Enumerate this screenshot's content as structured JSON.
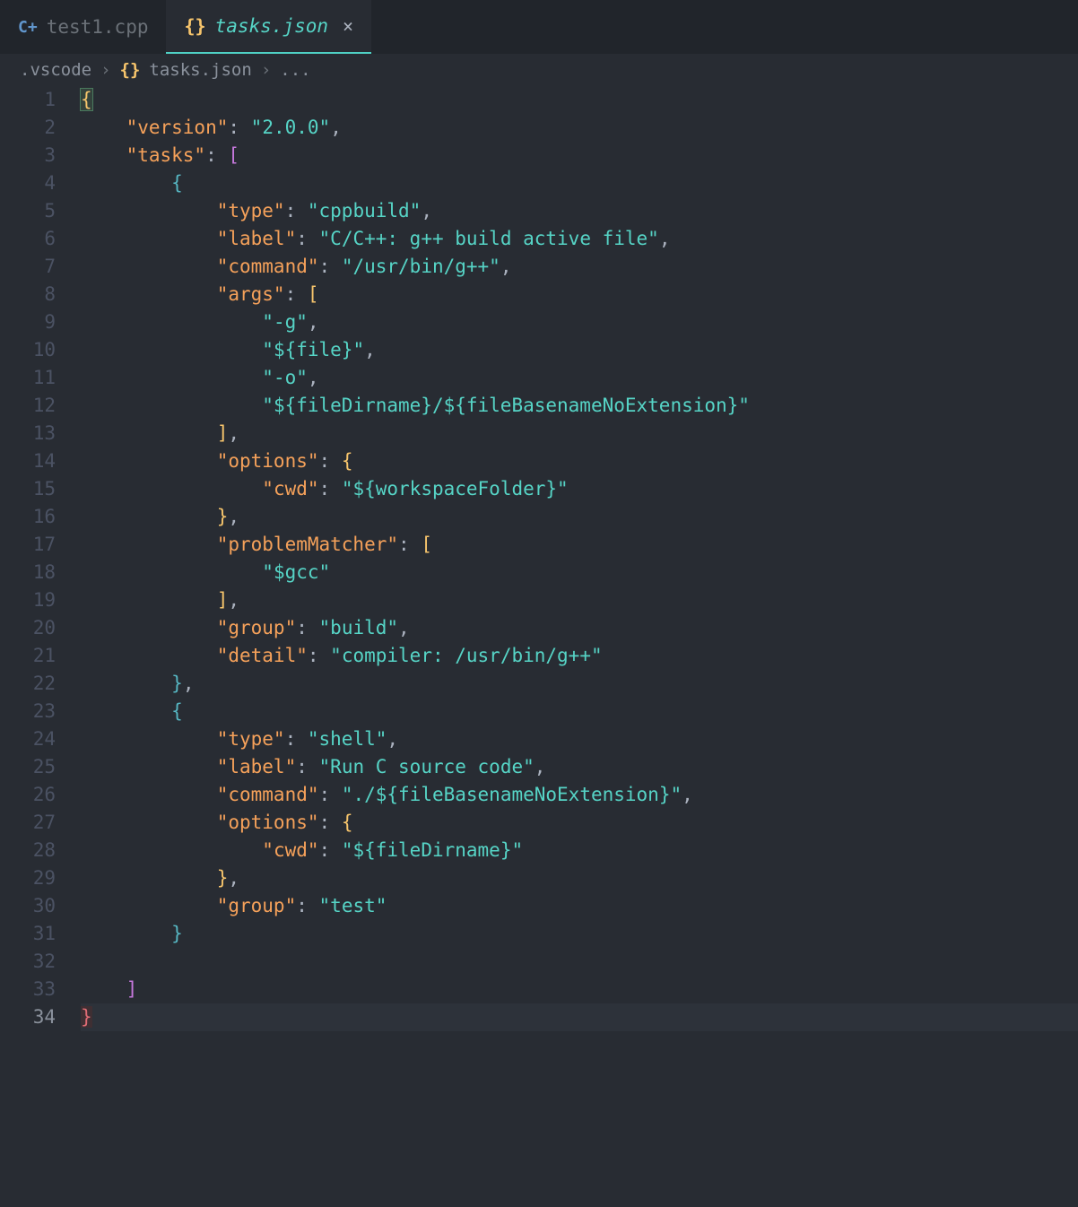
{
  "tabs": [
    {
      "label": "test1.cpp",
      "icon": "C+"
    },
    {
      "label": "tasks.json",
      "icon": "{}"
    }
  ],
  "breadcrumb": {
    "folder": ".vscode",
    "file": "tasks.json",
    "ellipsis": "..."
  },
  "line_numbers": [
    "1",
    "2",
    "3",
    "4",
    "5",
    "6",
    "7",
    "8",
    "9",
    "10",
    "11",
    "12",
    "13",
    "14",
    "15",
    "16",
    "17",
    "18",
    "19",
    "20",
    "21",
    "22",
    "23",
    "24",
    "25",
    "26",
    "27",
    "28",
    "29",
    "30",
    "31",
    "32",
    "33",
    "34"
  ],
  "tokens": {
    "open_brace": "{",
    "close_brace": "}",
    "open_bracket": "[",
    "close_bracket": "]",
    "comma": ",",
    "colon": ": ",
    "version_key": "\"version\"",
    "version_val": "\"2.0.0\"",
    "tasks_key": "\"tasks\"",
    "type_key": "\"type\"",
    "type_val1": "\"cppbuild\"",
    "label_key": "\"label\"",
    "label_val1": "\"C/C++: g++ build active file\"",
    "command_key": "\"command\"",
    "command_val1": "\"/usr/bin/g++\"",
    "args_key": "\"args\"",
    "arg_g": "\"-g\"",
    "arg_file": "\"${file}\"",
    "arg_o": "\"-o\"",
    "arg_out": "\"${fileDirname}/${fileBasenameNoExtension}\"",
    "options_key": "\"options\"",
    "cwd_key": "\"cwd\"",
    "cwd_val1": "\"${workspaceFolder}\"",
    "problemMatcher_key": "\"problemMatcher\"",
    "pm_val": "\"$gcc\"",
    "group_key": "\"group\"",
    "group_val1": "\"build\"",
    "detail_key": "\"detail\"",
    "detail_val1": "\"compiler: /usr/bin/g++\"",
    "type_val2": "\"shell\"",
    "label_val2": "\"Run C source code\"",
    "command_val2": "\"./${fileBasenameNoExtension}\"",
    "cwd_val2": "\"${fileDirname}\"",
    "group_val2": "\"test\""
  }
}
